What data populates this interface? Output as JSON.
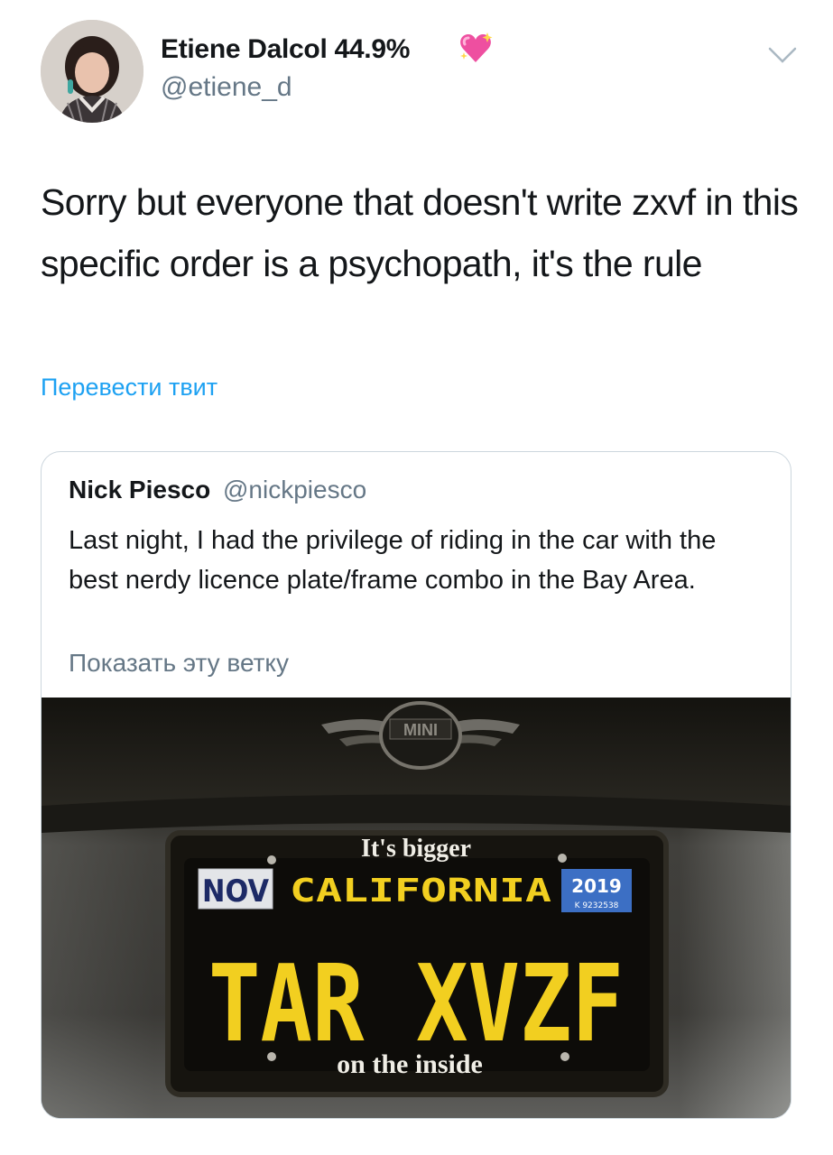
{
  "author": {
    "display_name": "Etiene Dalcol 44.9%",
    "handle": "@etiene_d",
    "name_emoji": "sparkling-heart-icon"
  },
  "tweet": {
    "text": "Sorry but everyone that doesn't write zxvf in this specific order is a psychopath, it's the rule",
    "translate_label": "Перевести твит"
  },
  "quoted_tweet": {
    "display_name": "Nick Piesco",
    "handle": "@nickpiesco",
    "text": "Last night, I had the privilege of riding in the car with the best nerdy licence plate/frame combo in the Bay Area.",
    "show_thread_label": "Показать эту ветку",
    "photo": {
      "badge": "MINI",
      "frame_top": "It's bigger",
      "frame_bottom": "on the inside",
      "month_sticker": "NOV",
      "state": "CALIFORNIA",
      "year_sticker": "2019",
      "sticker_code": "K 9232538",
      "plate_number": "TAR XVZF"
    }
  },
  "colors": {
    "link": "#1da1f2",
    "secondary_text": "#657786",
    "primary_text": "#14171a",
    "border": "#ccd6dd",
    "plate_yellow": "#f2cf20"
  }
}
